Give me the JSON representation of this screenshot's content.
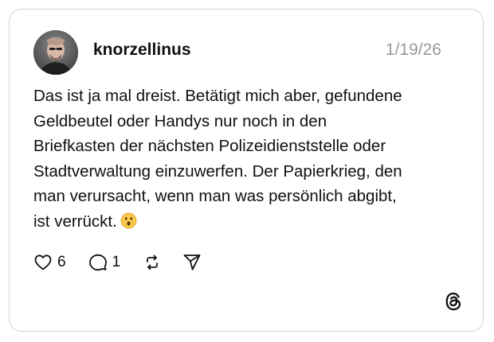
{
  "post": {
    "username": "knorzellinus",
    "date": "1/19/26",
    "text_lines": [
      "Das ist ja mal dreist. Betätigt mich aber, gefundene",
      "Geldbeutel oder Handys nur noch in den",
      "Briefkasten der nächsten Polizeidienststelle oder",
      "Stadtverwaltung einzuwerfen. Der Papierkrieg, den",
      "man verursacht, wenn man was persönlich abgibt,",
      "ist verrückt."
    ],
    "emoji": "face-with-open-mouth-emoji"
  },
  "actions": {
    "likes": "6",
    "replies": "1",
    "like_icon": "heart-icon",
    "reply_icon": "speech-bubble-icon",
    "repost_icon": "repost-icon",
    "share_icon": "send-icon"
  },
  "branding": {
    "logo": "threads-logo-icon"
  },
  "colors": {
    "text": "#101010",
    "muted": "#999999",
    "border": "#d4d4d4",
    "emoji_yellow": "#f7c64a"
  }
}
